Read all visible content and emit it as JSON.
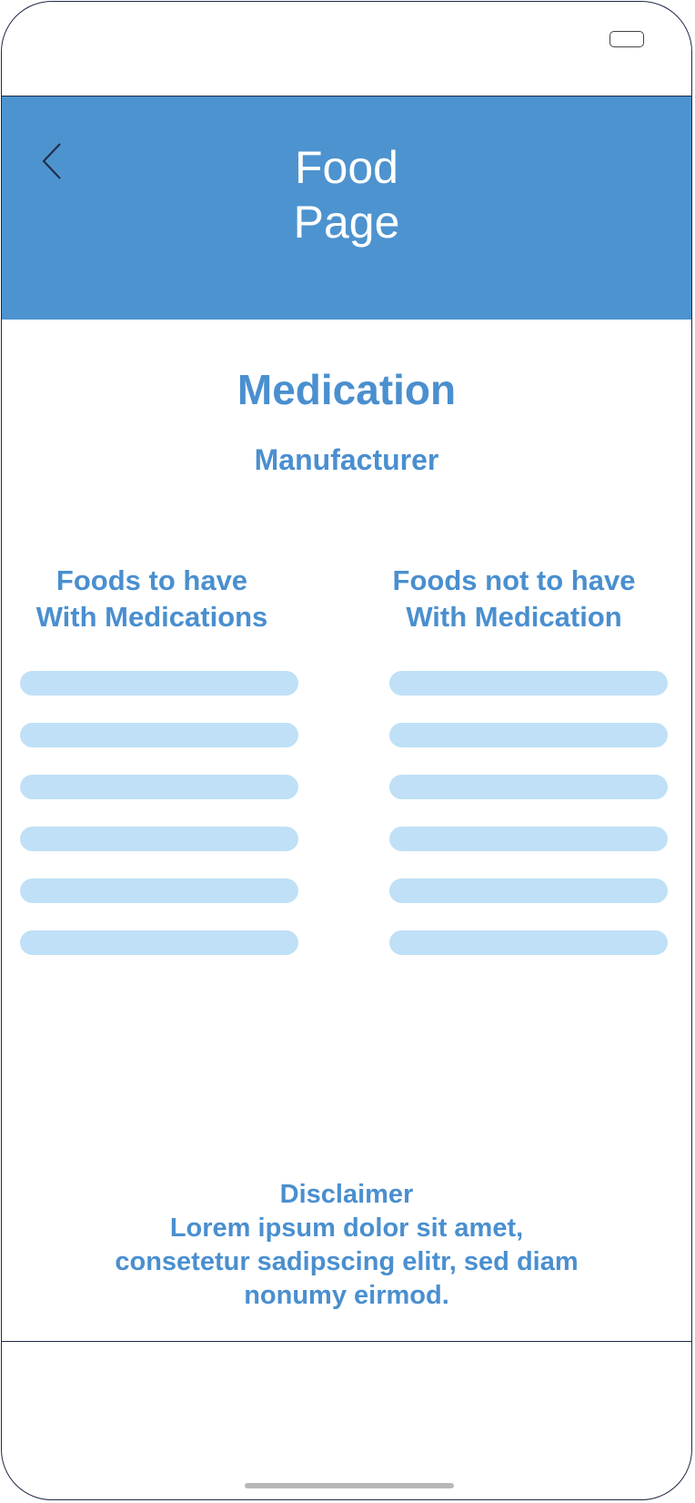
{
  "header": {
    "title": "Food\nPage"
  },
  "medication": {
    "name": "Medication",
    "manufacturer": "Manufacturer"
  },
  "columns": {
    "to_have": {
      "heading": "Foods to have\nWith Medications",
      "item_count": 6
    },
    "not_to_have": {
      "heading": "Foods not to have\nWith Medication",
      "item_count": 6
    }
  },
  "disclaimer": {
    "title": "Disclaimer",
    "body": "Lorem ipsum dolor sit amet,\nconsetetur sadipscing elitr, sed diam\nnonumy eirmod."
  },
  "icons": {
    "back": "chevron-left-icon",
    "battery": "battery-icon"
  },
  "colors": {
    "header_bg": "#4d93cf",
    "accent_text": "#4a8fcf",
    "list_placeholder": "#bfe0f6"
  }
}
